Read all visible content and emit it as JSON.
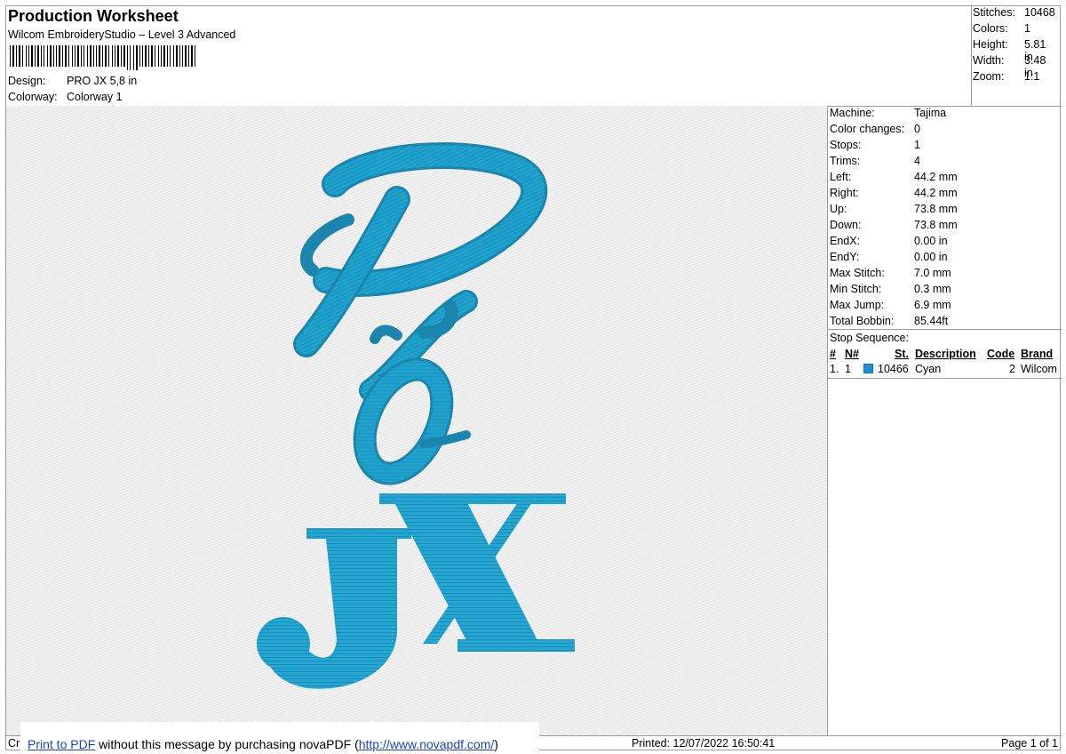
{
  "header": {
    "title": "Production Worksheet",
    "subtitle": "Wilcom EmbroideryStudio – Level 3 Advanced",
    "design_label": "Design:",
    "design_value": "PRO JX 5,8 in",
    "colorway_label": "Colorway:",
    "colorway_value": "Colorway 1"
  },
  "summary": [
    {
      "label": "Stitches:",
      "value": "10468"
    },
    {
      "label": "Colors:",
      "value": "1"
    },
    {
      "label": "Height:",
      "value": "5.81 in"
    },
    {
      "label": "Width:",
      "value": "3.48 in"
    },
    {
      "label": "Zoom:",
      "value": "1:1"
    }
  ],
  "machine_info": [
    {
      "label": "Machine:",
      "value": "Tajima"
    },
    {
      "label": "Color changes:",
      "value": "0"
    },
    {
      "label": "Stops:",
      "value": "1"
    },
    {
      "label": "Trims:",
      "value": "4"
    },
    {
      "label": "Left:",
      "value": "44.2 mm"
    },
    {
      "label": "Right:",
      "value": "44.2 mm"
    },
    {
      "label": "Up:",
      "value": "73.8 mm"
    },
    {
      "label": "Down:",
      "value": "73.8 mm"
    },
    {
      "label": "EndX:",
      "value": "0.00 in"
    },
    {
      "label": "EndY:",
      "value": "0.00 in"
    },
    {
      "label": "Max Stitch:",
      "value": "7.0 mm"
    },
    {
      "label": "Min Stitch:",
      "value": "0.3 mm"
    },
    {
      "label": "Max Jump:",
      "value": "6.9 mm"
    },
    {
      "label": "Total Bobbin:",
      "value": "85.44ft"
    }
  ],
  "stop_sequence": {
    "label": "Stop Sequence:",
    "headers": {
      "num": "#",
      "n": "N#",
      "st": "St.",
      "description": "Description",
      "code": "Code",
      "brand": "Brand"
    },
    "rows": [
      {
        "num": "1.",
        "n": "1",
        "st": "10466",
        "description": "Cyan",
        "code": "2",
        "brand": "Wilcom",
        "color": "#1e90d6"
      }
    ]
  },
  "preview": {
    "thread_color": "#1fa3cf"
  },
  "footer": {
    "crop_text": "Cr",
    "banner_link1": "Print to PDF",
    "banner_mid": " without this message by purchasing novaPDF (",
    "banner_link2": "http://www.novapdf.com/",
    "banner_end": ")",
    "printed": "Printed: 12/07/2022 16:50:41",
    "page": "Page 1 of 1"
  }
}
